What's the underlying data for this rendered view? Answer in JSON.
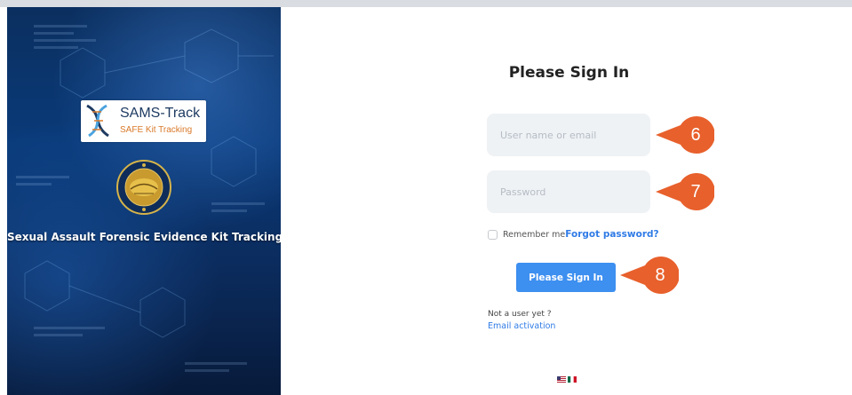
{
  "left_panel": {
    "logo_title": "SAMS-Track",
    "logo_subtitle": "SAFE Kit Tracking",
    "heading": "Sexual Assault Forensic Evidence Kit Tracking"
  },
  "form": {
    "title": "Please Sign In",
    "username_placeholder": "User name or email",
    "password_placeholder": "Password",
    "remember_label": "Remember me",
    "remember_checked": false,
    "forgot_link": "Forgot password?",
    "submit_label": "Please Sign In",
    "not_user_text": "Not a user yet ?",
    "activation_link": "Email activation"
  },
  "callouts": [
    "6",
    "7",
    "8"
  ],
  "languages": [
    "us-flag-icon",
    "mexico-flag-icon"
  ],
  "colors": {
    "accent": "#3d8ff0",
    "link": "#2f7be6",
    "callout": "#e8602c",
    "panel": "#0a3a79"
  }
}
